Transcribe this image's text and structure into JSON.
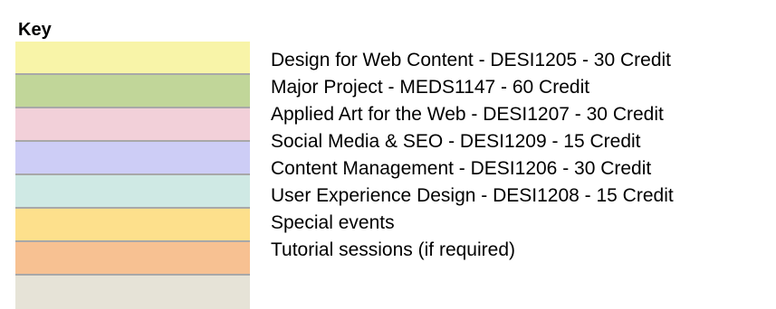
{
  "key": {
    "title": "Key",
    "items": [
      {
        "label": "Design for Web Content - DESI1205 - 30 Credit",
        "color": "#f8f4a8"
      },
      {
        "label": "Major Project - MEDS1147 - 60 Credit",
        "color": "#c1d699"
      },
      {
        "label": "Applied Art for the Web - DESI1207 - 30 Credit",
        "color": "#f2d0d9"
      },
      {
        "label": "Social Media & SEO - DESI1209 - 15 Credit",
        "color": "#cdcdf6"
      },
      {
        "label": "Content Management - DESI1206 - 30 Credit",
        "color": "#cfe9e4"
      },
      {
        "label": "User Experience Design - DESI1208 - 15 Credit",
        "color": "#fde08c"
      },
      {
        "label": "Special events",
        "color": "#f7c192"
      },
      {
        "label": "Tutorial sessions (if required)",
        "color": "#e6e3d7"
      }
    ]
  }
}
